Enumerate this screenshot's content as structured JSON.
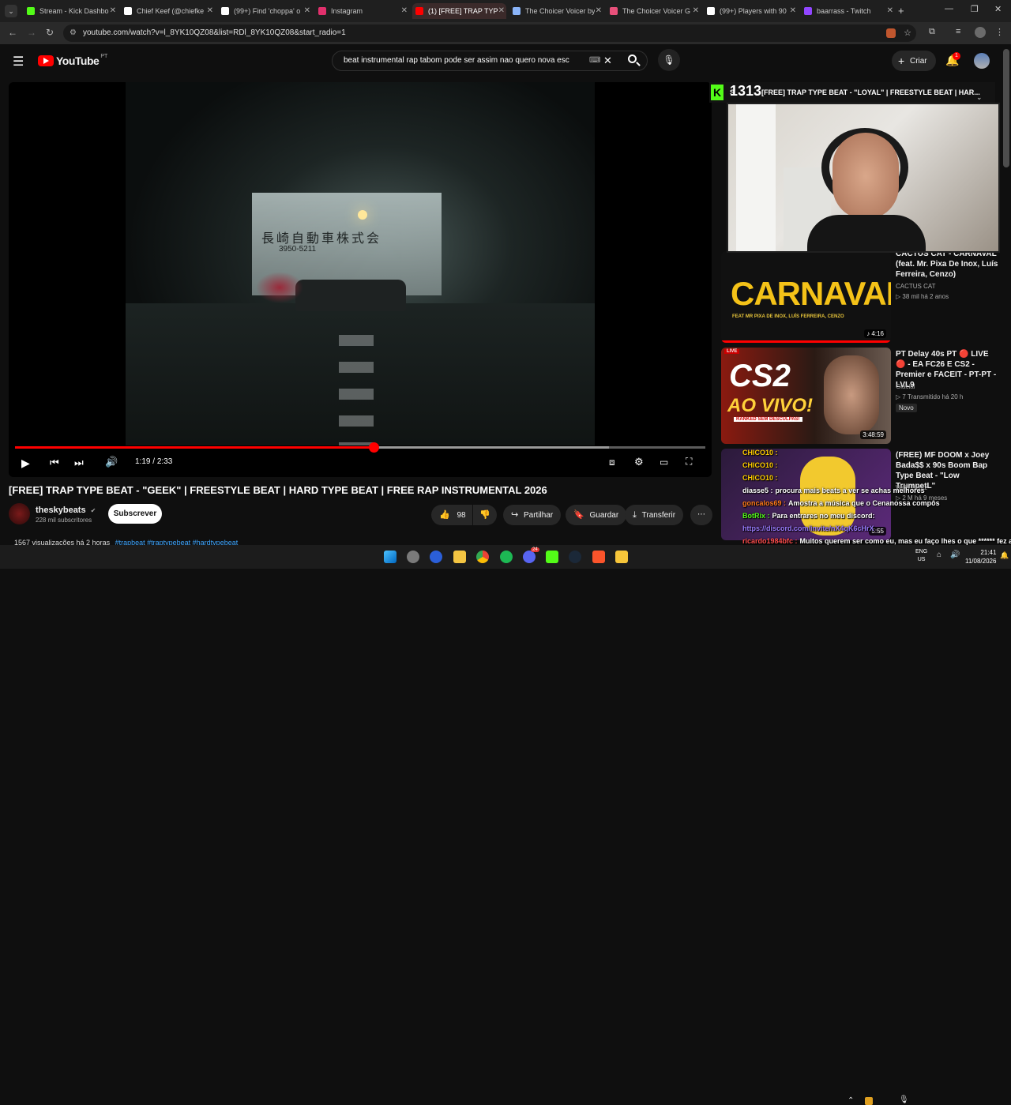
{
  "browser": {
    "tabs": [
      {
        "label": "Stream - Kick Dashbo",
        "color": "#53fc18"
      },
      {
        "label": "Chief Keef (@chiefke",
        "color": "#ffffff"
      },
      {
        "label": "(99+) Find 'choppa' o",
        "color": "#ffffff"
      },
      {
        "label": "Instagram",
        "color": "#e1306c"
      },
      {
        "label": "(1) [FREE] TRAP TYPE",
        "color": "#ff0000"
      },
      {
        "label": "The Choicer Voicer by",
        "color": "#8ab4f8"
      },
      {
        "label": "The Choicer Voicer G",
        "color": "#e8507a"
      },
      {
        "label": "(99+) Players with 90",
        "color": "#ffffff"
      },
      {
        "label": "baarrass - Twitch",
        "color": "#9146ff"
      }
    ],
    "url": "youtube.com/watch?v=l_8YK10QZ08&list=RDl_8YK10QZ08&start_radio=1"
  },
  "header": {
    "brand": "YouTube",
    "region": "PT",
    "search_query": "beat instrumental rap tabom pode ser assim nao quero nova esc",
    "create_label": "Criar",
    "notif_count": "1"
  },
  "player": {
    "time_current": "1:19",
    "time_total": "2:33",
    "progress_fraction": 0.52,
    "buffer_fraction": 0.86,
    "sign_text": "長崎自動車株式会",
    "sign_phone": "3950-5211"
  },
  "video": {
    "title": "[FREE] TRAP TYPE BEAT - \"GEEK\" | FREESTYLE BEAT | HARD TYPE BEAT | FREE RAP INSTRUMENTAL 2026",
    "channel": "theskybeats",
    "subscribers": "228 mil subscritores",
    "subscribe_label": "Subscrever",
    "likes": "98",
    "share_label": "Partilhar",
    "save_label": "Guardar",
    "download_label": "Transferir",
    "views_time": "1567 visualizações há 2 horas",
    "tags": "#trapbeat #traptypebeat #hardtypebeat"
  },
  "overlay": {
    "viewer_count": "1313",
    "now_playing": "[FREE] TRAP TYPE BEAT - \"LOYAL\" | FREESTYLE BEAT | HAR...",
    "now_playing_prefix": "S"
  },
  "sidebar": {
    "items": [
      {
        "title": "CACTUS CAT - CARNAVAL (feat. Mr. Pixa De Inox, Luís Ferreira, Cenzo)",
        "channel": "CACTUS CAT",
        "meta": "▷ 38 mil   há 2 anos",
        "duration": "4:16",
        "thumb_text": "CARNAVAL",
        "thumb_sub": "FEAT MR PIXA DE INOX, LUÍS FERREIRA, CENZO"
      },
      {
        "title": "PT Delay 40s PT 🔴 LIVE 🔴 - EA FC26 E CS2 - Premier e FACEIT - PT-PT - LVL9",
        "channel": "Glacial",
        "meta": "▷ 7   Transmitido há 20 h",
        "badge": "Novo",
        "duration": "3:48:59",
        "thumb_text": "CS2",
        "thumb_sub": "AO VIVO!",
        "live": "LIVE",
        "thumb_tag": "RANKED SEM DESCULPAS!"
      },
      {
        "title": "(FREE) MF DOOM x Joey Bada$$ x 90s Boom Bap Type Beat - \"Low TrumpetL\"",
        "channel": "Wais Beatz",
        "meta": "▷ 2 M   há 9 meses",
        "duration": "5:55"
      }
    ]
  },
  "chat": {
    "lines": [
      {
        "user": "CHICO10 :",
        "msg": "",
        "color": "#ffcc00"
      },
      {
        "user": "CHICO10 :",
        "msg": "",
        "color": "#ffcc00"
      },
      {
        "user": "CHICO10 :",
        "msg": "",
        "color": "#ffcc00"
      },
      {
        "user": "diasse5 :",
        "msg": "procura mais beats a ver se achas melhores",
        "color": "#ffffff"
      },
      {
        "user": "goncalos69 :",
        "msg": "Amostra a música que o Cenanossa compôs",
        "color": "#ff7a1a"
      },
      {
        "user": "BotRix :",
        "msg": "Para entrares no meu discord:",
        "color": "#53fc18"
      },
      {
        "user": "",
        "msg": "https://discord.com/invite/nX4qK6cHrX",
        "color": "#9b7bff"
      },
      {
        "user": "ricardo1984bfc :",
        "msg": "Muitos querem ser como eu, mas eu faço lhes o que ****** fez ao judeu",
        "color": "#ff4d4d"
      }
    ]
  },
  "taskbar": {
    "lang_top": "ENG",
    "lang_bottom": "US",
    "time": "21:41",
    "date": "11/08/2026",
    "discord_badge": "24"
  }
}
